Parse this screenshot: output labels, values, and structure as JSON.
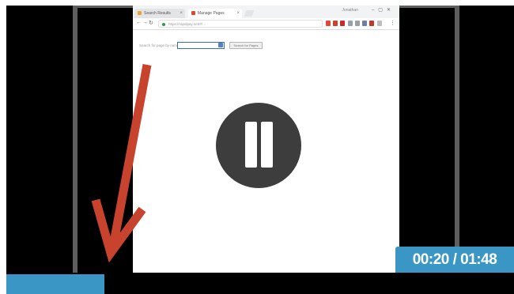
{
  "player": {
    "time_current": "00:20",
    "time_total": "01:48",
    "time_display": "00:20 / 01:48",
    "progress_fraction": 0.1935,
    "state": "playing",
    "accent_color": "#3a96c4",
    "pause_icon": "pause-icon"
  },
  "screen": {
    "tabs": [
      {
        "label": "Search Results",
        "favicon": "page-icon"
      },
      {
        "label": "Manage Pages",
        "favicon": "page-icon"
      }
    ],
    "window_user": "Jonathan",
    "omnibox_url": "https://rapidpay.net/#/…",
    "form_label": "Search for page by name:",
    "form_button_label": "Search for Pages"
  },
  "annotation": {
    "arrow_color": "#c7432e",
    "arrow_icon": "arrow-down-left-icon"
  }
}
